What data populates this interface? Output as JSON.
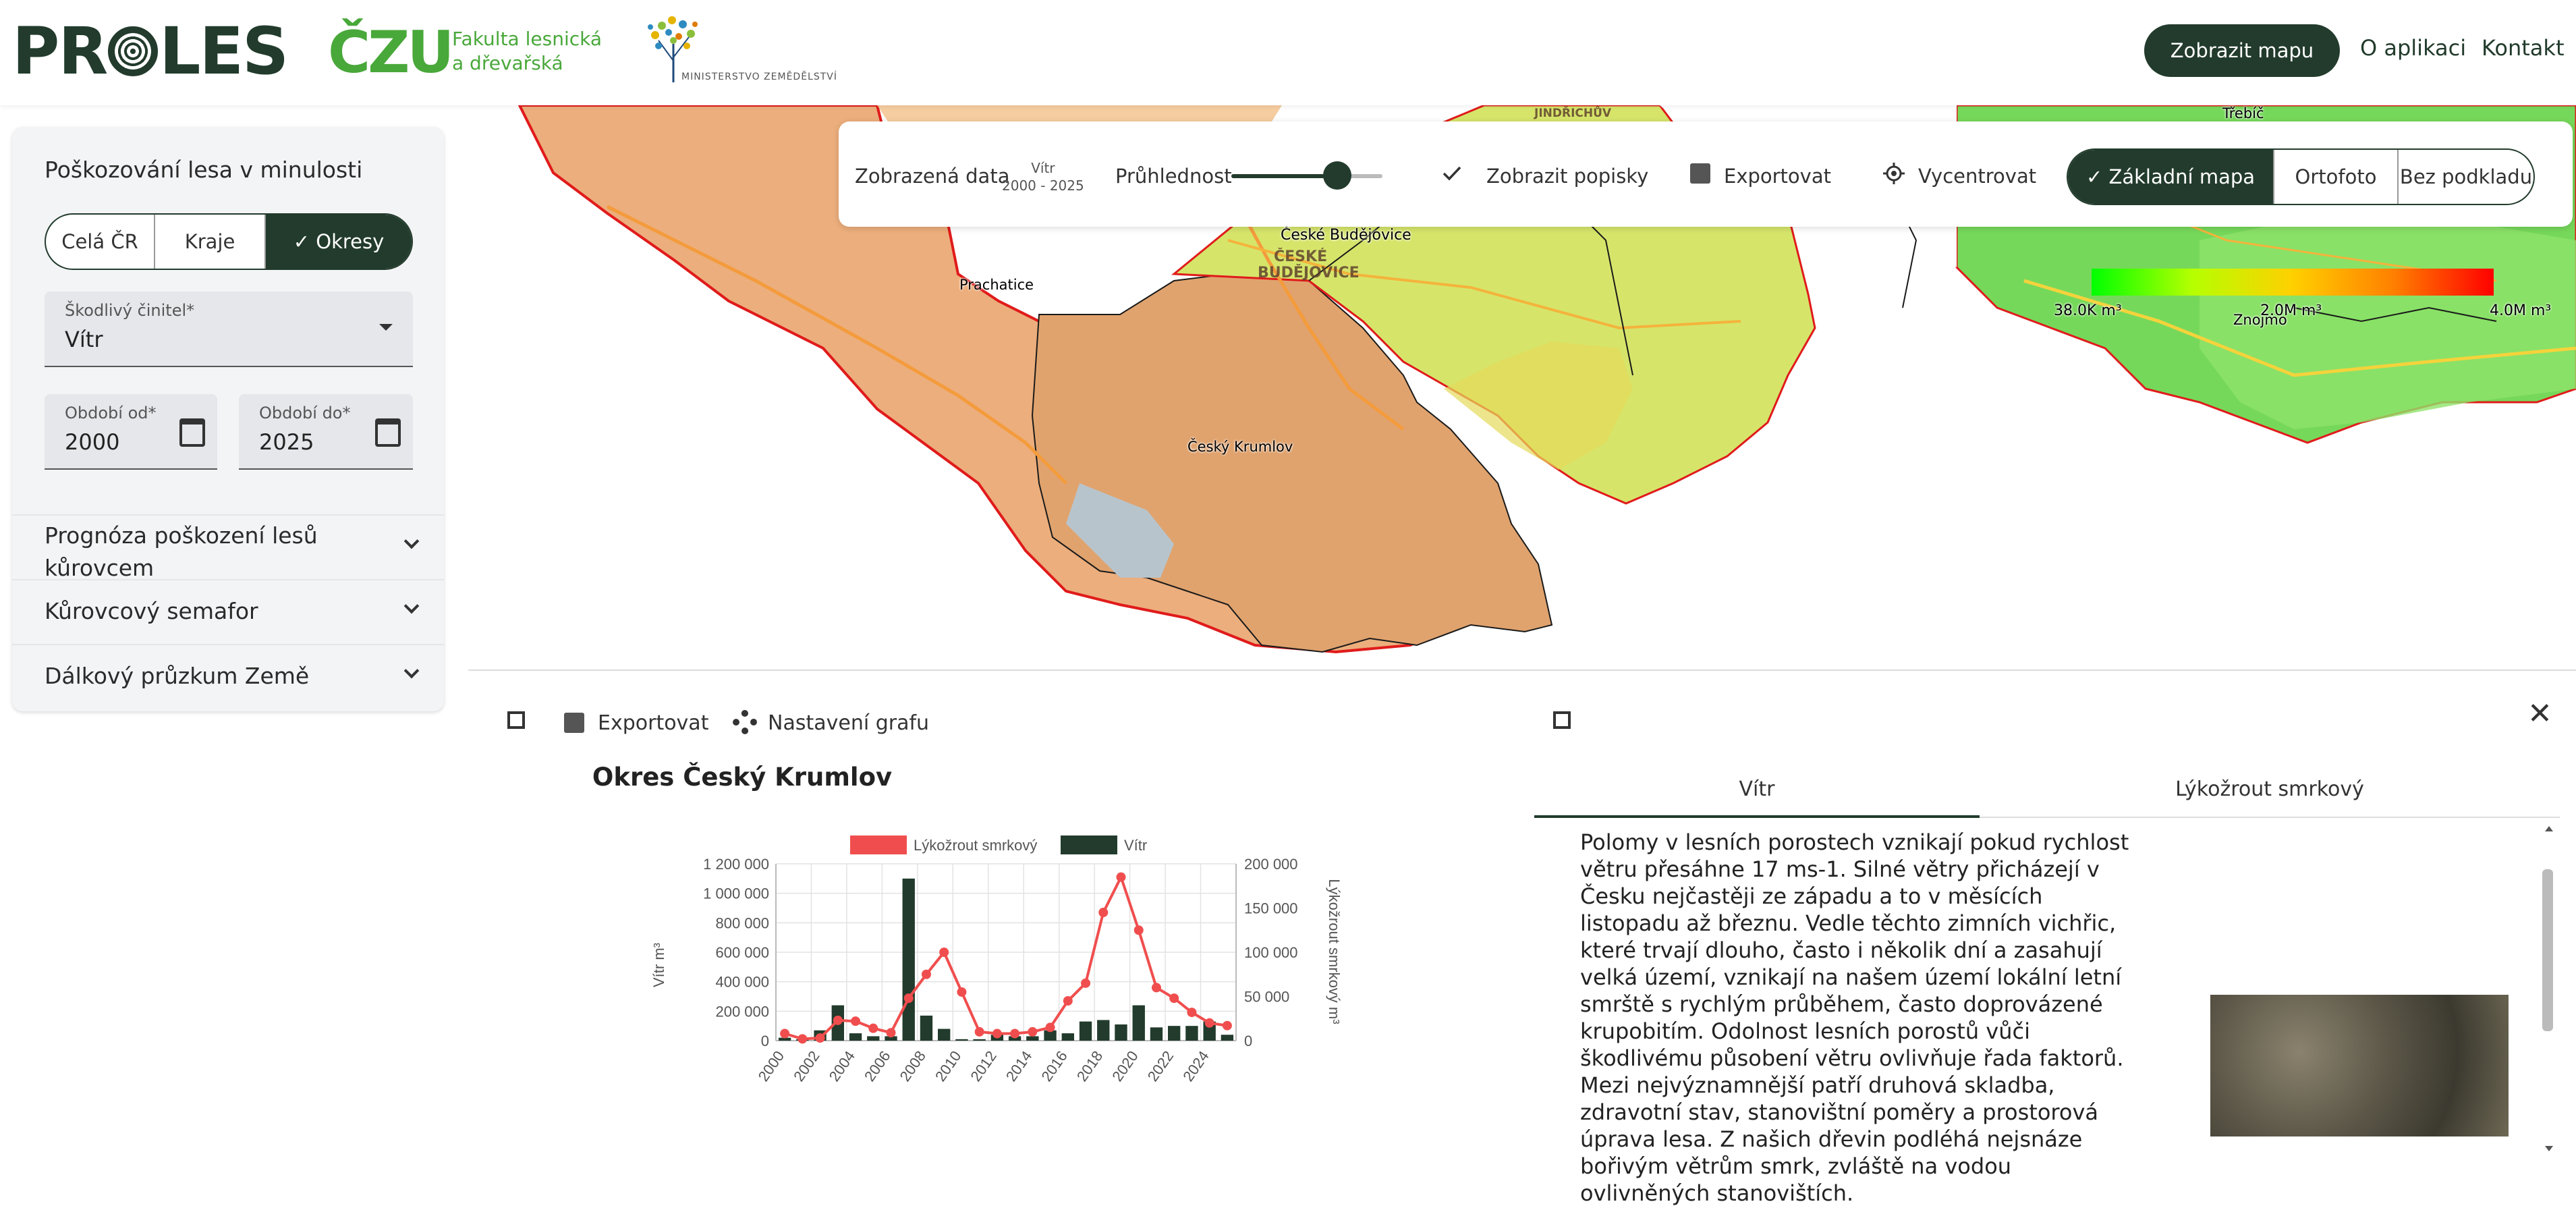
{
  "header": {
    "logo_proles": "PROLES",
    "logo_czu": "ČZU",
    "czu_line1": "Fakulta lesnická",
    "czu_line2": "a dřevařská",
    "mze_text": "MINISTERSTVO ZEMĚDĚLSTVÍ",
    "show_map_button": "Zobrazit mapu",
    "nav_about": "O aplikaci",
    "nav_contact": "Kontakt"
  },
  "toolbar": {
    "displayed_data_label": "Zobrazená data",
    "data_name": "Vítr",
    "data_period": "2000 - 2025",
    "opacity_label": "Průhlednost",
    "opacity_value": 0.7,
    "show_labels": "Zobrazit popisky",
    "export": "Exportovat",
    "center": "Vycentrovat",
    "base_maps": [
      "Základní mapa",
      "Ortofoto",
      "Bez podkladu"
    ],
    "base_map_selected": "Základní mapa"
  },
  "legend": {
    "min_label": "38.0K m³",
    "mid_label": "2.0M m³",
    "max_label": "4.0M m³",
    "colors": [
      "#00ff00",
      "#b5ff00",
      "#ffd000",
      "#ff8000",
      "#ff0000"
    ]
  },
  "map": {
    "labels": {
      "ceske_budejovice": "České Budějovice",
      "prachatice": "Prachatice",
      "cesky_krumlov": "Český Krumlov",
      "znojmo": "Znojmo",
      "trebic": "Třebíč",
      "jindrichuv": "JINDŘICHŮV",
      "ceske": "ČESKÉ",
      "budejovice": "BUDĚJOVICE"
    }
  },
  "left_panel": {
    "title": "Poškozování lesa v minulosti",
    "scope_options": [
      "Celá ČR",
      "Kraje",
      "Okresy"
    ],
    "scope_selected": "Okresy",
    "agent_label": "Škodlivý činitel*",
    "agent_value": "Vítr",
    "from_label": "Období od*",
    "from_value": "2000",
    "to_label": "Období do*",
    "to_value": "2025",
    "sections": [
      "Prognóza poškození lesů kůrovcem",
      "Kůrovcový semafor",
      "Dálkový průzkum Země"
    ]
  },
  "chart_panel": {
    "export": "Exportovat",
    "settings": "Nastavení grafu"
  },
  "chart_data": {
    "type": "bar",
    "title": "Okres Český Krumlov",
    "x": [
      2000,
      2001,
      2002,
      2003,
      2004,
      2005,
      2006,
      2007,
      2008,
      2009,
      2010,
      2011,
      2012,
      2013,
      2014,
      2015,
      2016,
      2017,
      2018,
      2019,
      2020,
      2021,
      2022,
      2023,
      2024,
      2025
    ],
    "x_tick_labels": [
      "2000",
      "2002",
      "2004",
      "2006",
      "2008",
      "2010",
      "2012",
      "2014",
      "2016",
      "2018",
      "2020",
      "2022",
      "2024"
    ],
    "series": [
      {
        "name": "Vítr",
        "type": "bar",
        "axis": "left",
        "color": "#223b2c",
        "values": [
          20000,
          10000,
          70000,
          240000,
          50000,
          30000,
          30000,
          1100000,
          170000,
          80000,
          10000,
          10000,
          40000,
          30000,
          30000,
          70000,
          50000,
          130000,
          140000,
          110000,
          240000,
          90000,
          100000,
          100000,
          130000,
          40000
        ]
      },
      {
        "name": "Lýkožrout smrkový",
        "type": "line",
        "axis": "right",
        "color": "#f04e4e",
        "values": [
          8000,
          2000,
          3000,
          23000,
          22000,
          14000,
          9000,
          48000,
          75000,
          100000,
          55000,
          10000,
          8000,
          8000,
          10000,
          15000,
          45000,
          65000,
          145000,
          185000,
          125000,
          60000,
          48000,
          32000,
          20000,
          17000
        ]
      }
    ],
    "ylabel": "Vítr m³",
    "y2label": "Lýkožrout smrkový m³",
    "ylim": [
      0,
      1200000
    ],
    "y2lim": [
      0,
      200000
    ],
    "y_ticks": [
      "0",
      "200 000",
      "400 000",
      "600 000",
      "800 000",
      "1 000 000",
      "1 200 000"
    ],
    "y2_ticks": [
      "0",
      "50 000",
      "100 000",
      "150 000",
      "200 000"
    ],
    "grid": true,
    "legend": "top"
  },
  "description": {
    "tabs": [
      "Vítr",
      "Lýkožrout smrkový"
    ],
    "tab_selected": "Vítr",
    "text": "Polomy v lesních porostech vznikají pokud rychlost větru přesáhne 17 ms-1. Silné větry přicházejí v Česku nejčastěji ze západu a to v měsících listopadu až březnu. Vedle těchto zimních vichřic, které trvají dlouho, často i několik dní a zasahují velká území, vznikají na našem území lokální letní smrště s rychlým průběhem, často doprovázené krupobitím. Odolnost lesních porostů vůči škodlivému působení větru ovlivňuje řada faktorů. Mezi nejvýznamnější patří druhová skladba, zdravotní stav, stanovištní poměry a prostorová úprava lesa. Z našich dřevin podléhá nejsnáze bořivým větrům smrk, zvláště na vodou ovlivněných stanovištích."
  }
}
